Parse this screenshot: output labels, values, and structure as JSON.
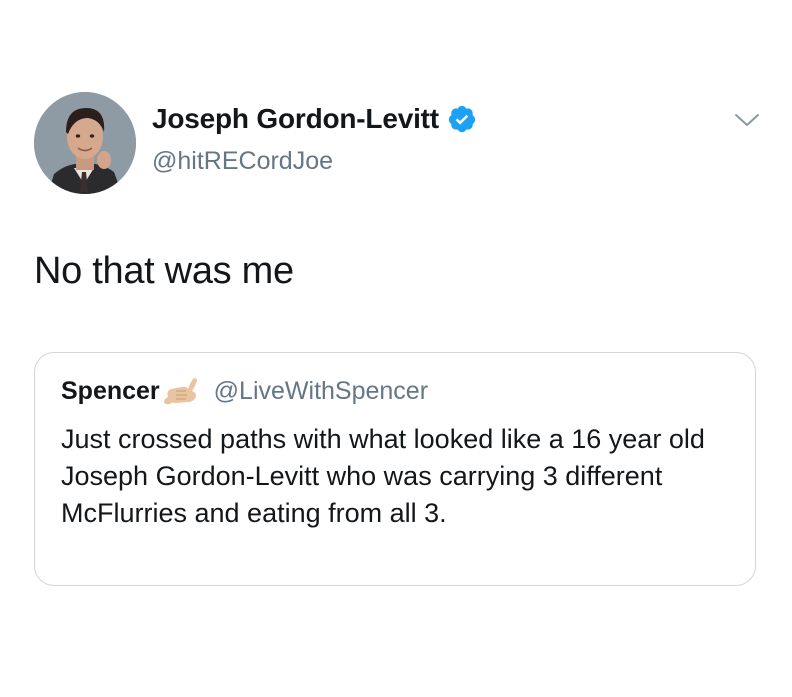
{
  "tweet": {
    "author": {
      "display_name": "Joseph Gordon-Levitt",
      "handle": "@hitRECordJoe",
      "verified": true,
      "avatar_icon": "profile-photo"
    },
    "text": "No that was me",
    "menu_icon": "chevron-down-icon"
  },
  "quoted_tweet": {
    "author": {
      "display_name": "Spencer",
      "emoji": "call-me-hand-icon",
      "handle": "@LiveWithSpencer"
    },
    "text": "Just crossed paths with what looked like a 16 year old Joseph Gordon-Levitt who was carrying 3 different McFlurries and eating from all 3."
  },
  "colors": {
    "primary_text": "#14171a",
    "secondary_text": "#657786",
    "verified_blue": "#1da1f2",
    "card_border": "#d0d6db",
    "background": "#ffffff"
  }
}
